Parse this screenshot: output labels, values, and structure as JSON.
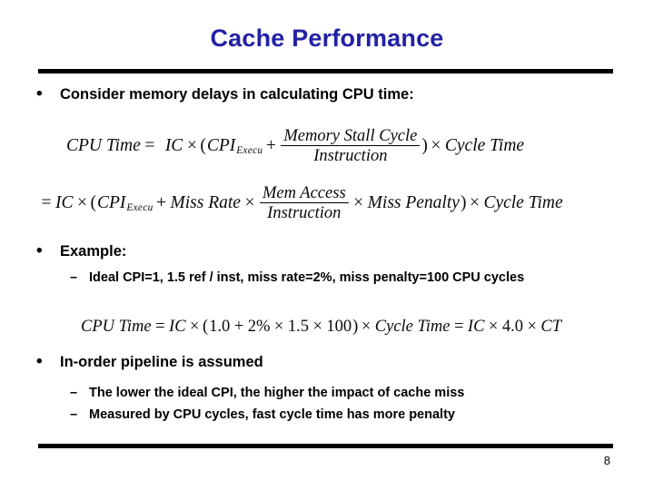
{
  "slide": {
    "title": "Cache Performance",
    "title_color": "#2121a5",
    "page_number": "8",
    "background": "#ffffff"
  },
  "bullets": [
    {
      "marker": "•",
      "text": "Consider memory delays in calculating CPU time:"
    },
    {
      "marker": "•",
      "text": "Example:"
    },
    {
      "marker": "•",
      "text": "In-order pipeline is assumed"
    }
  ],
  "sub_bullets": [
    {
      "marker": "–",
      "text": "Ideal CPI=1,  1.5 ref / inst,  miss rate=2%,  miss penalty=100 CPU cycles"
    },
    {
      "marker": "–",
      "text": "The lower the ideal CPI, the higher the impact of cache miss"
    },
    {
      "marker": "–",
      "text": "Measured by CPU cycles, fast cycle time has more penalty"
    }
  ],
  "equations": {
    "eq1": {
      "lhs": "CPU Time",
      "equals": "=",
      "ic": "IC",
      "times1": "×",
      "open_paren": "(",
      "cpi": "CPI",
      "cpi_sub": "Execu",
      "plus": "+",
      "frac_num": "Memory Stall Cycle",
      "frac_den": "Instruction",
      "close_paren": ")",
      "times2": "×",
      "cycle_time": "Cycle Time"
    },
    "eq2": {
      "equals": "=",
      "ic": "IC",
      "times1": "×",
      "open_paren": "(",
      "cpi": "CPI",
      "cpi_sub": "Execu",
      "plus": "+",
      "miss_rate": "Miss Rate",
      "times2": "×",
      "frac_num": "Mem Access",
      "frac_den": "Instruction",
      "times3": "×",
      "miss_penalty": "Miss Penalty",
      "close_paren": ")",
      "times4": "×",
      "cycle_time": "Cycle Time"
    },
    "eq3": {
      "lhs": "CPU Time",
      "equals1": "=",
      "ic1": "IC",
      "times1": "×",
      "open_paren": "(",
      "one": "1.0",
      "plus": "+",
      "pct": "2%",
      "times2": "×",
      "ref": "1.5",
      "times3": "×",
      "penalty": "100",
      "close_paren": ")",
      "times4": "×",
      "cycle_time": "Cycle Time",
      "equals2": "=",
      "ic2": "IC",
      "times5": "×",
      "result": "4.0",
      "times6": "×",
      "ct": "CT"
    }
  }
}
